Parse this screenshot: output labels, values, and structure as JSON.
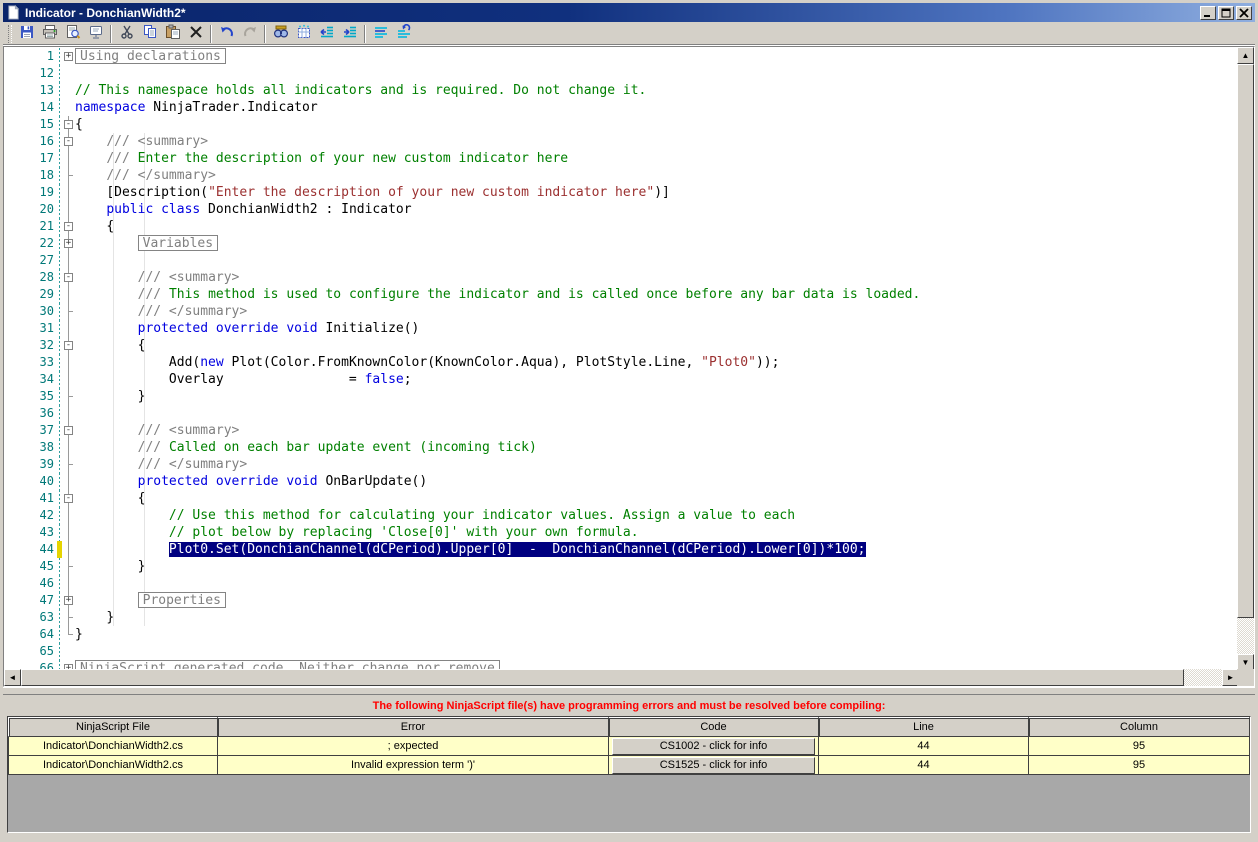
{
  "window": {
    "title": "Indicator - DonchianWidth2*",
    "controls": [
      "minimize",
      "maximize",
      "close"
    ]
  },
  "toolbar": {
    "groups": [
      [
        "save",
        "print",
        "print-preview",
        "presentation"
      ],
      [
        "cut",
        "copy",
        "paste",
        "delete"
      ],
      [
        "undo",
        "redo"
      ],
      [
        "find",
        "grid",
        "outdent",
        "indent"
      ],
      [
        "comment",
        "uncomment"
      ]
    ]
  },
  "editor": {
    "lines": [
      {
        "n": "1",
        "fold": "plus",
        "ind": 0,
        "box": "Using declarations"
      },
      {
        "n": "12",
        "fold": "none",
        "ind": 0,
        "parts": []
      },
      {
        "n": "13",
        "fold": "none",
        "ind": 0,
        "parts": [
          [
            "cmt",
            "// This namespace holds all indicators and is required. Do not change it."
          ]
        ]
      },
      {
        "n": "14",
        "fold": "none",
        "ind": 0,
        "parts": [
          [
            "kw",
            "namespace"
          ],
          [
            "pln",
            " NinjaTrader.Indicator"
          ]
        ]
      },
      {
        "n": "15",
        "fold": "minus",
        "ind": 0,
        "parts": [
          [
            "pln",
            "{"
          ]
        ]
      },
      {
        "n": "16",
        "fold": "minus",
        "ind": 1,
        "parts": [
          [
            "doc",
            "/// <summary>"
          ]
        ]
      },
      {
        "n": "17",
        "fold": "line",
        "ind": 1,
        "parts": [
          [
            "doc",
            "/// "
          ],
          [
            "cmt",
            "Enter the description of your new custom indicator here"
          ]
        ]
      },
      {
        "n": "18",
        "fold": "tick",
        "ind": 1,
        "parts": [
          [
            "doc",
            "/// </summary>"
          ]
        ]
      },
      {
        "n": "19",
        "fold": "line",
        "ind": 1,
        "parts": [
          [
            "pln",
            "[Description("
          ],
          [
            "str",
            "\"Enter the description of your new custom indicator here\""
          ],
          [
            "pln",
            ")]"
          ]
        ]
      },
      {
        "n": "20",
        "fold": "line",
        "ind": 1,
        "parts": [
          [
            "kw",
            "public class"
          ],
          [
            "pln",
            " DonchianWidth2 : Indicator"
          ]
        ]
      },
      {
        "n": "21",
        "fold": "minus",
        "ind": 1,
        "parts": [
          [
            "pln",
            "{"
          ]
        ]
      },
      {
        "n": "22",
        "fold": "plusv",
        "ind": 2,
        "box": "Variables"
      },
      {
        "n": "27",
        "fold": "line",
        "ind": 0,
        "parts": []
      },
      {
        "n": "28",
        "fold": "minus",
        "ind": 2,
        "parts": [
          [
            "doc",
            "/// <summary>"
          ]
        ]
      },
      {
        "n": "29",
        "fold": "line",
        "ind": 2,
        "parts": [
          [
            "doc",
            "/// "
          ],
          [
            "cmt",
            "This method is used to configure the indicator and is called once before any bar data is loaded."
          ]
        ]
      },
      {
        "n": "30",
        "fold": "tick",
        "ind": 2,
        "parts": [
          [
            "doc",
            "/// </summary>"
          ]
        ]
      },
      {
        "n": "31",
        "fold": "line",
        "ind": 2,
        "parts": [
          [
            "kw",
            "protected override void"
          ],
          [
            "pln",
            " Initialize()"
          ]
        ]
      },
      {
        "n": "32",
        "fold": "minus",
        "ind": 2,
        "parts": [
          [
            "pln",
            "{"
          ]
        ]
      },
      {
        "n": "33",
        "fold": "line",
        "ind": 3,
        "parts": [
          [
            "pln",
            "Add("
          ],
          [
            "kw",
            "new"
          ],
          [
            "pln",
            " Plot(Color.FromKnownColor(KnownColor.Aqua), PlotStyle.Line, "
          ],
          [
            "str",
            "\"Plot0\""
          ],
          [
            "pln",
            "));"
          ]
        ]
      },
      {
        "n": "34",
        "fold": "line",
        "ind": 3,
        "parts": [
          [
            "pln",
            "Overlay                = "
          ],
          [
            "kw",
            "false"
          ],
          [
            "pln",
            ";"
          ]
        ]
      },
      {
        "n": "35",
        "fold": "tick",
        "ind": 2,
        "parts": [
          [
            "pln",
            "}"
          ]
        ]
      },
      {
        "n": "36",
        "fold": "line",
        "ind": 0,
        "parts": []
      },
      {
        "n": "37",
        "fold": "minus",
        "ind": 2,
        "parts": [
          [
            "doc",
            "/// <summary>"
          ]
        ]
      },
      {
        "n": "38",
        "fold": "line",
        "ind": 2,
        "parts": [
          [
            "doc",
            "/// "
          ],
          [
            "cmt",
            "Called on each bar update event (incoming tick)"
          ]
        ]
      },
      {
        "n": "39",
        "fold": "tick",
        "ind": 2,
        "parts": [
          [
            "doc",
            "/// </summary>"
          ]
        ]
      },
      {
        "n": "40",
        "fold": "line",
        "ind": 2,
        "parts": [
          [
            "kw",
            "protected override void"
          ],
          [
            "pln",
            " OnBarUpdate()"
          ]
        ]
      },
      {
        "n": "41",
        "fold": "minus",
        "ind": 2,
        "parts": [
          [
            "pln",
            "{"
          ]
        ]
      },
      {
        "n": "42",
        "fold": "line",
        "ind": 3,
        "parts": [
          [
            "cmt",
            "// Use this method for calculating your indicator values. Assign a value to each"
          ]
        ]
      },
      {
        "n": "43",
        "fold": "line",
        "ind": 3,
        "parts": [
          [
            "cmt",
            "// plot below by replacing 'Close[0]' with your own formula."
          ]
        ]
      },
      {
        "n": "44",
        "fold": "line",
        "ind": 3,
        "mark": true,
        "parts": [
          [
            "sel",
            "Plot0.Set(DonchianChannel(dCPeriod).Upper[0]  -  DonchianChannel(dCPeriod).Lower[0])*100;"
          ]
        ]
      },
      {
        "n": "45",
        "fold": "tick",
        "ind": 2,
        "parts": [
          [
            "pln",
            "}"
          ]
        ]
      },
      {
        "n": "46",
        "fold": "line",
        "ind": 0,
        "parts": []
      },
      {
        "n": "47",
        "fold": "plusv",
        "ind": 2,
        "box": "Properties"
      },
      {
        "n": "63",
        "fold": "tick",
        "ind": 1,
        "parts": [
          [
            "pln",
            "}"
          ]
        ]
      },
      {
        "n": "64",
        "fold": "endstop",
        "ind": 0,
        "parts": [
          [
            "pln",
            "}"
          ]
        ]
      },
      {
        "n": "65",
        "fold": "none",
        "ind": 0,
        "parts": []
      },
      {
        "n": "66",
        "fold": "plus",
        "ind": 0,
        "box": "NinjaScript generated code. Neither change nor remove"
      }
    ]
  },
  "error_panel": {
    "message": "The following NinjaScript file(s) have programming errors and must be resolved before compiling:",
    "table": {
      "headers": [
        "NinjaScript File",
        "Error",
        "Code",
        "Line",
        "Column"
      ],
      "rows": [
        {
          "file": "Indicator\\DonchianWidth2.cs",
          "error": "; expected",
          "code": "CS1002 - click for info",
          "line": "44",
          "column": "95"
        },
        {
          "file": "Indicator\\DonchianWidth2.cs",
          "error": "Invalid expression term ')'",
          "code": "CS1525 - click for info",
          "line": "44",
          "column": "95"
        }
      ]
    }
  },
  "colors": {
    "titlebar_left": "#0A246A",
    "titlebar_right": "#8FAEDF",
    "selection_bg": "#000080",
    "line_number": "#007878",
    "keyword": "#0000E0",
    "comment": "#008000",
    "doc_comment": "#808080",
    "string": "#9B3030",
    "error_text": "#FF0000",
    "table_row_bg": "#FFFFC8",
    "chrome": "#D4D0C8",
    "changed_line_marker": "#E6D400"
  }
}
